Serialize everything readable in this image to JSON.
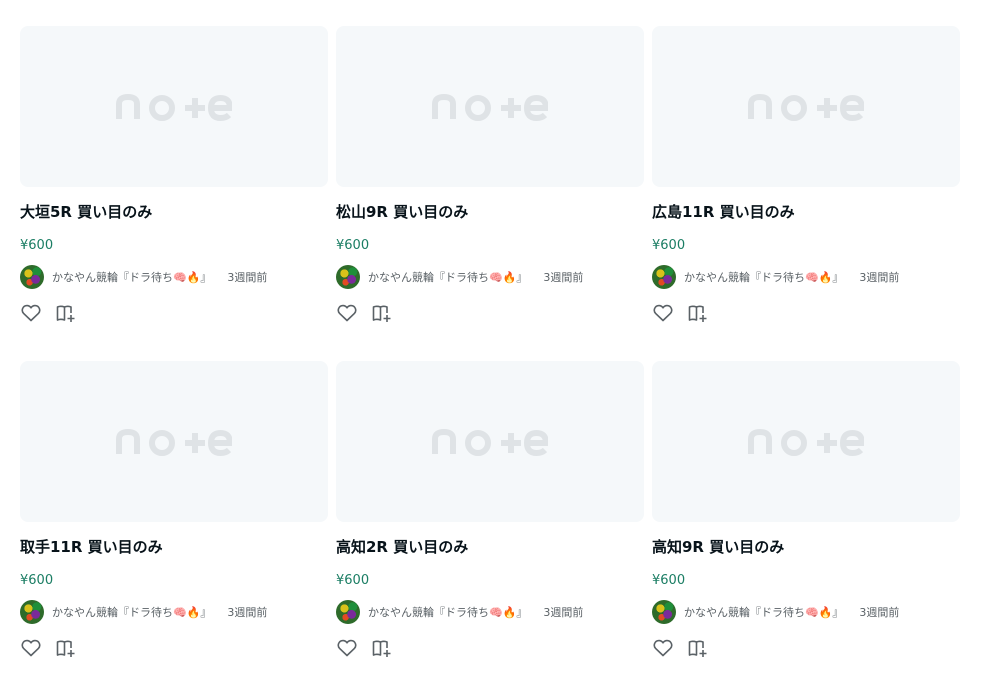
{
  "logo_text": "note",
  "cards": [
    {
      "title": "大垣5R 買い目のみ",
      "price": "¥600",
      "author": "かなやん競輪『ドラ待ち🧠🔥』",
      "time": "3週間前"
    },
    {
      "title": "松山9R 買い目のみ",
      "price": "¥600",
      "author": "かなやん競輪『ドラ待ち🧠🔥』",
      "time": "3週間前"
    },
    {
      "title": "広島11R 買い目のみ",
      "price": "¥600",
      "author": "かなやん競輪『ドラ待ち🧠🔥』",
      "time": "3週間前"
    },
    {
      "title": "取手11R 買い目のみ",
      "price": "¥600",
      "author": "かなやん競輪『ドラ待ち🧠🔥』",
      "time": "3週間前"
    },
    {
      "title": "高知2R 買い目のみ",
      "price": "¥600",
      "author": "かなやん競輪『ドラ待ち🧠🔥』",
      "time": "3週間前"
    },
    {
      "title": "高知9R 買い目のみ",
      "price": "¥600",
      "author": "かなやん競輪『ドラ待ち🧠🔥』",
      "time": "3週間前"
    }
  ],
  "icons": {
    "like": "heart-icon",
    "magazine": "magazine-add-icon",
    "placeholder": "note-logo"
  },
  "colors": {
    "thumb_bg": "#f5f8fa",
    "logo": "#dfe3e6",
    "price": "#1a7d63",
    "meta_text": "#5a6166",
    "icon": "#5a6166"
  }
}
